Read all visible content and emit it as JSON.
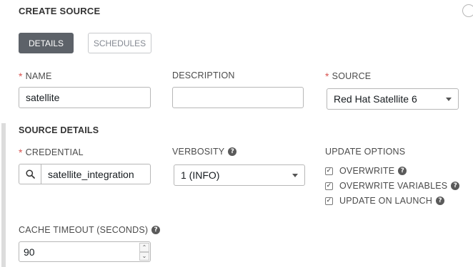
{
  "panel": {
    "title": "CREATE SOURCE"
  },
  "tabs": {
    "details": "DETAILS",
    "schedules": "SCHEDULES"
  },
  "fields": {
    "name": {
      "label": "NAME",
      "value": "satellite",
      "required": true
    },
    "description": {
      "label": "DESCRIPTION",
      "value": ""
    },
    "source": {
      "label": "SOURCE",
      "selected": "Red Hat Satellite 6",
      "required": true
    }
  },
  "source_details": {
    "title": "SOURCE DETAILS",
    "credential": {
      "label": "CREDENTIAL",
      "value": "satellite_integration",
      "required": true
    },
    "verbosity": {
      "label": "VERBOSITY",
      "selected": "1 (INFO)"
    },
    "update_options": {
      "label": "UPDATE OPTIONS",
      "items": [
        {
          "label": "OVERWRITE",
          "checked": true
        },
        {
          "label": "OVERWRITE VARIABLES",
          "checked": true
        },
        {
          "label": "UPDATE ON LAUNCH",
          "checked": true
        }
      ]
    },
    "cache_timeout": {
      "label": "CACHE TIMEOUT (SECONDS)",
      "value": "90"
    }
  },
  "icons": {
    "help": "question-circle-icon",
    "search": "search-icon",
    "caret": "caret-down-icon",
    "check": "checkmark-icon"
  },
  "colors": {
    "required": "#d9534f",
    "active_tab": "#5d6269",
    "inactive_tab_text": "#848992"
  }
}
